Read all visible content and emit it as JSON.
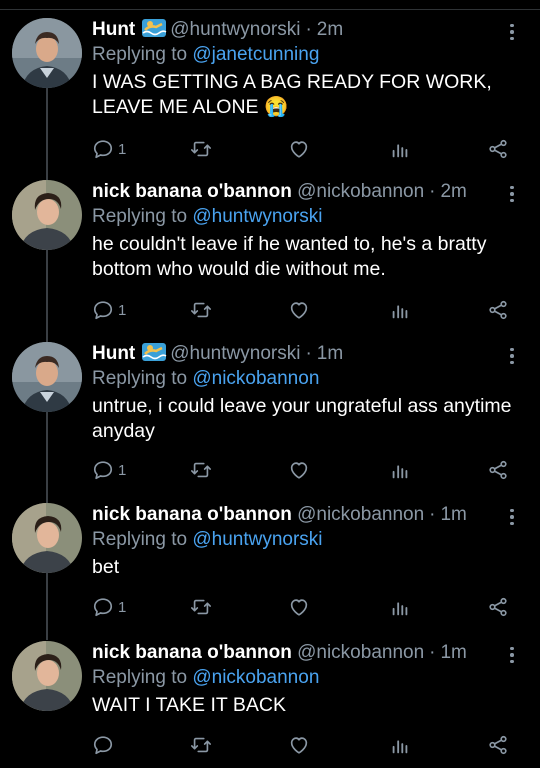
{
  "tweets": [
    {
      "name": "Hunt",
      "handle": "@huntwynorski",
      "sep": "·",
      "time": "2m",
      "reply_prefix": "Replying to",
      "reply_to": "@janetcunning",
      "text": "I WAS GETTING A BAG READY FOR WORK, LEAVE ME ALONE 😭",
      "reply_count": "1",
      "avatar": "hunt",
      "badge": "swimmer-emoji-icon"
    },
    {
      "name": "nick banana o'bannon",
      "handle": "@nickobannon",
      "sep": "·",
      "time": "2m",
      "reply_prefix": "Replying to",
      "reply_to": "@huntwynorski",
      "text": "he couldn't leave if he wanted to, he's a bratty bottom who would die without me.",
      "reply_count": "1",
      "avatar": "nick",
      "badge": ""
    },
    {
      "name": "Hunt",
      "handle": "@huntwynorski",
      "sep": "·",
      "time": "1m",
      "reply_prefix": "Replying to",
      "reply_to": "@nickobannon",
      "text": "untrue, i could leave your ungrateful ass anytime anyday",
      "reply_count": "1",
      "avatar": "hunt",
      "badge": "swimmer-emoji-icon"
    },
    {
      "name": "nick banana o'bannon",
      "handle": "@nickobannon",
      "sep": "·",
      "time": "1m",
      "reply_prefix": "Replying to",
      "reply_to": "@huntwynorski",
      "text": "bet",
      "reply_count": "1",
      "avatar": "nick",
      "badge": ""
    },
    {
      "name": "nick banana o'bannon",
      "handle": "@nickobannon",
      "sep": "·",
      "time": "1m",
      "reply_prefix": "Replying to",
      "reply_to": "@nickobannon",
      "text": "WAIT I TAKE IT BACK",
      "reply_count": "",
      "avatar": "nick",
      "badge": ""
    }
  ],
  "colors": {
    "background": "#000000",
    "name": "#ffffff",
    "muted": "#8b98a5",
    "link": "#4aa3f0",
    "thread_line": "#3a3f44"
  },
  "icons": [
    "reply-icon",
    "retweet-icon",
    "like-icon",
    "analytics-icon",
    "share-icon",
    "more-options-icon"
  ]
}
